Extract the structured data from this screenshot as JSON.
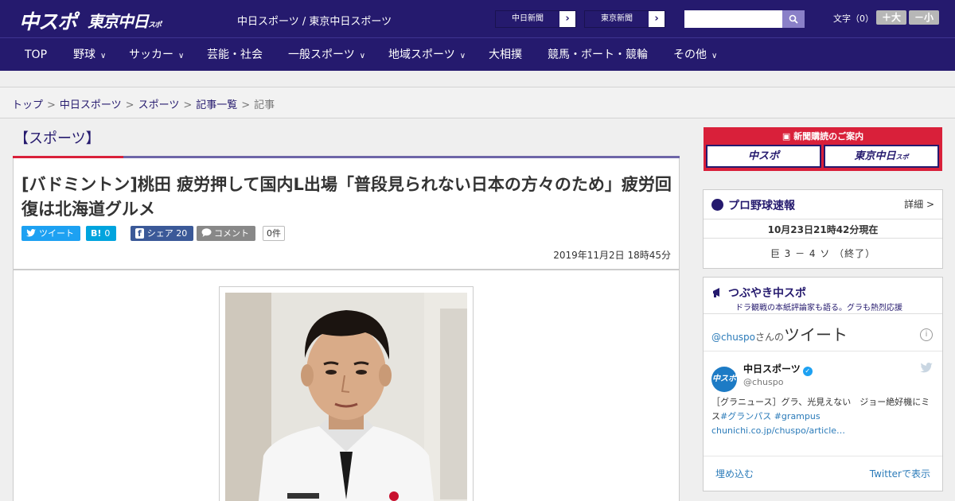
{
  "header": {
    "logo_chuspo": "中スポ",
    "logo_tokyo": "東京中日",
    "logo_tokyo_sub": "スポ",
    "site_name": "中日スポーツ / 東京中日スポーツ",
    "paper_buttons": [
      "中日新聞",
      "東京新聞"
    ],
    "search_placeholder": "",
    "font_size_label": "文字（0）",
    "font_plus": "＋大",
    "font_minus": "－小"
  },
  "nav": [
    {
      "label": "TOP",
      "dropdown": false
    },
    {
      "label": "野球",
      "dropdown": true
    },
    {
      "label": "サッカー",
      "dropdown": true
    },
    {
      "label": "芸能・社会",
      "dropdown": false
    },
    {
      "label": "一般スポーツ",
      "dropdown": true
    },
    {
      "label": "地域スポーツ",
      "dropdown": true
    },
    {
      "label": "大相撲",
      "dropdown": false
    },
    {
      "label": "競馬・ボート・競輪",
      "dropdown": false
    },
    {
      "label": "その他",
      "dropdown": true
    }
  ],
  "breadcrumb": [
    "トップ",
    "中日スポーツ",
    "スポーツ",
    "記事一覧",
    "記事"
  ],
  "section_title": "【スポーツ】",
  "article": {
    "headline": "[バドミントン]桃田 疲労押して国内L出場「普段見られない日本の方々のため」疲労回復は北海道グルメ",
    "share": {
      "tweet": "ツイート",
      "hatena_icon": "B!",
      "hatena_count": "0",
      "facebook_icon": "f",
      "facebook_label": "シェア",
      "facebook_count": "20",
      "comment_label": "コメント",
      "comment_count": "0件"
    },
    "date": "2019年11月2日 18時45分"
  },
  "sidebar": {
    "subscribe_title": "新聞購読のご案内",
    "subscribe_chuspo": "中スポ",
    "subscribe_tokyo": "東京中日",
    "subscribe_tokyo_sub": "スポ",
    "baseball": {
      "title": "プロ野球速報",
      "detail_link": "詳細 >",
      "timestamp": "10月23日21時42分現在",
      "score_line": "巨 3 － 4 ソ （終了）"
    },
    "tweets": {
      "title": "つぶやき中スポ",
      "subtitle": "ドラ観戦の本紙評論家も語る。グラも熱烈応援",
      "handle_link": "@chuspo",
      "handle_suffix": "さんの",
      "tweet_heading": "ツイート",
      "account_name": "中日スポーツ",
      "account_handle": "@chuspo",
      "avatar_text": "中スポ",
      "tweet_text_1": "［グラニュース］グラ、光見えない　ジョー絶好機にミス",
      "tweet_hashtag_1": "#グランパス",
      "tweet_hashtag_2": "#grampus",
      "tweet_link": "chunichi.co.jp/chuspo/article…",
      "embed_label": "埋め込む",
      "view_on_twitter": "Twitterで表示"
    }
  },
  "colors": {
    "brand_navy": "#251a6e",
    "accent_red": "#d9203a",
    "twitter_blue": "#1da1f2",
    "hatena_blue": "#00a4de",
    "facebook_blue": "#3b5998",
    "comment_grey": "#888888"
  }
}
